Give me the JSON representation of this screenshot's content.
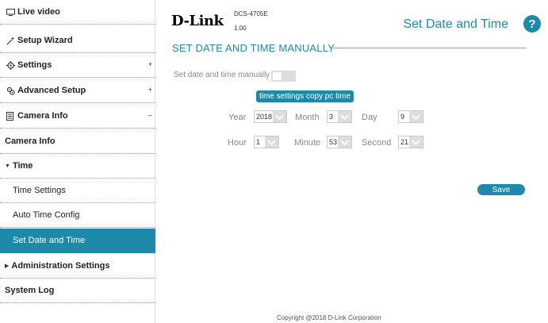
{
  "sidebar": {
    "items": [
      {
        "label": "Live video",
        "icon": "monitor-icon"
      },
      {
        "label": "Setup Wizard",
        "icon": "wand-icon"
      },
      {
        "label": "Settings",
        "icon": "gear-icon",
        "expander": "+"
      },
      {
        "label": "Advanced Setup",
        "icon": "gears-icon",
        "expander": "+"
      },
      {
        "label": "Camera Info",
        "icon": "document-icon",
        "expander": "–"
      },
      {
        "label": "Camera Info"
      },
      {
        "label": "Time"
      },
      {
        "label": "Time Settings"
      },
      {
        "label": "Auto Time Config"
      },
      {
        "label": "Set Date and Time"
      },
      {
        "label": "Administration Settings"
      },
      {
        "label": "System Log"
      }
    ]
  },
  "header": {
    "logo": "D-Link",
    "model": "DCS-4705E",
    "firmware": "1.00",
    "page_title": "Set Date and Time",
    "help_label": "?"
  },
  "section": {
    "title": "SET DATE AND TIME MANUALLY"
  },
  "form": {
    "toggle_label": "Set date and time manually",
    "toggle_on": false,
    "copy_button": "time settings copy pc time",
    "year_label": "Year",
    "year_value": "2018",
    "month_label": "Month",
    "month_value": "3",
    "day_label": "Day",
    "day_value": "9",
    "hour_label": "Hour",
    "hour_value": "1",
    "minute_label": "Minute",
    "minute_value": "53",
    "second_label": "Second",
    "second_value": "21",
    "save_button": "Save"
  },
  "footer": {
    "copyright": "Copyright @2018 D-Link Corporation"
  },
  "colors": {
    "accent": "#1e8aaa",
    "select_arrow_bg": "#dddddd",
    "toggle_off": "#dddddd"
  }
}
